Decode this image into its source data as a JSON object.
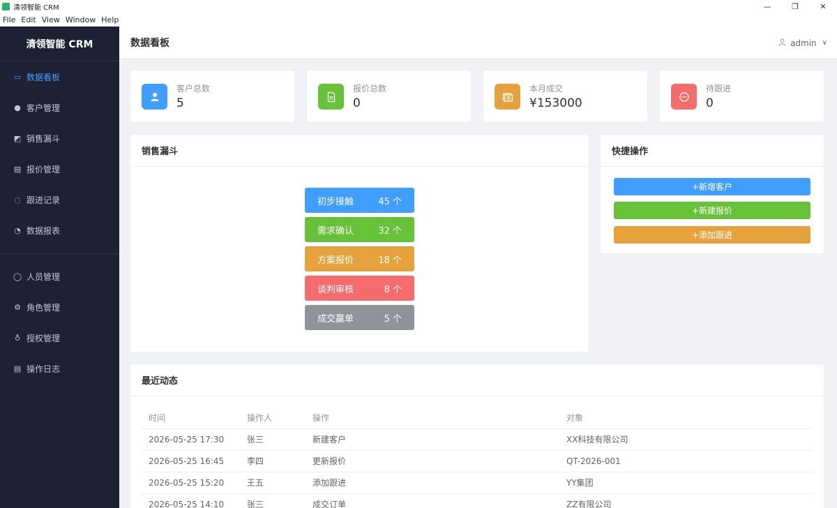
{
  "window": {
    "title": "清领智能 CRM",
    "menus": [
      "File",
      "Edit",
      "View",
      "Window",
      "Help"
    ],
    "controls": {
      "minimize": "—",
      "restore": "❐",
      "close": "✕"
    }
  },
  "sidebar": {
    "brand": "清领智能 CRM",
    "items": [
      {
        "label": "数据看板",
        "icon": "monitor-icon",
        "glyph": "▭"
      },
      {
        "label": "客户管理",
        "icon": "user-icon",
        "glyph": "●"
      },
      {
        "label": "销售漏斗",
        "icon": "chart-icon",
        "glyph": "◩"
      },
      {
        "label": "报价管理",
        "icon": "document-icon",
        "glyph": "▤"
      },
      {
        "label": "跟进记录",
        "icon": "chat-icon",
        "glyph": "◌"
      },
      {
        "label": "数据报表",
        "icon": "pie-chart-icon",
        "glyph": "◔"
      }
    ],
    "admin_items": [
      {
        "label": "人员管理",
        "icon": "user-outline-icon",
        "glyph": "◯"
      },
      {
        "label": "角色管理",
        "icon": "gear-icon",
        "glyph": "⚙"
      },
      {
        "label": "授权管理",
        "icon": "key-icon",
        "glyph": "♁"
      },
      {
        "label": "操作日志",
        "icon": "log-icon",
        "glyph": "▤"
      }
    ],
    "active_index": 0
  },
  "header": {
    "title": "数据看板",
    "user": "admin",
    "user_icon": "user-icon",
    "chevron": "∨"
  },
  "stats": [
    {
      "label": "客户总数",
      "value": "5",
      "color": "#409eff",
      "icon": "user-icon",
      "glyph": "👤"
    },
    {
      "label": "报价总数",
      "value": "0",
      "color": "#67c23a",
      "icon": "document-icon",
      "glyph": "🗎"
    },
    {
      "label": "本月成交",
      "value": "¥153000",
      "color": "#e6a23c",
      "icon": "money-icon",
      "glyph": "▣"
    },
    {
      "label": "待跟进",
      "value": "0",
      "color": "#f56c6c",
      "icon": "chat-icon",
      "glyph": "💬"
    }
  ],
  "funnel": {
    "title": "销售漏斗",
    "stages": [
      {
        "label": "初步接触",
        "count": "45 个",
        "color": "#409eff"
      },
      {
        "label": "需求确认",
        "count": "32 个",
        "color": "#67c23a"
      },
      {
        "label": "方案报价",
        "count": "18 个",
        "color": "#e6a23c"
      },
      {
        "label": "谈判审核",
        "count": "8 个",
        "color": "#f56c6c"
      },
      {
        "label": "成交赢单",
        "count": "5 个",
        "color": "#909399"
      }
    ]
  },
  "quick_actions": {
    "title": "快捷操作",
    "buttons": [
      {
        "label": "+新增客户",
        "color": "#409eff"
      },
      {
        "label": "+新建报价",
        "color": "#67c23a"
      },
      {
        "label": "+添加跟进",
        "color": "#e6a23c"
      }
    ]
  },
  "recent": {
    "title": "最近动态",
    "columns": [
      "时间",
      "操作人",
      "操作",
      "对象"
    ],
    "rows": [
      [
        "2026-05-25 17:30",
        "张三",
        "新建客户",
        "XX科技有限公司"
      ],
      [
        "2026-05-25 16:45",
        "李四",
        "更新报价",
        "QT-2026-001"
      ],
      [
        "2026-05-25 15:20",
        "王五",
        "添加跟进",
        "YY集团"
      ],
      [
        "2026-05-25 14:10",
        "张三",
        "成交订单",
        "ZZ有限公司"
      ]
    ]
  }
}
